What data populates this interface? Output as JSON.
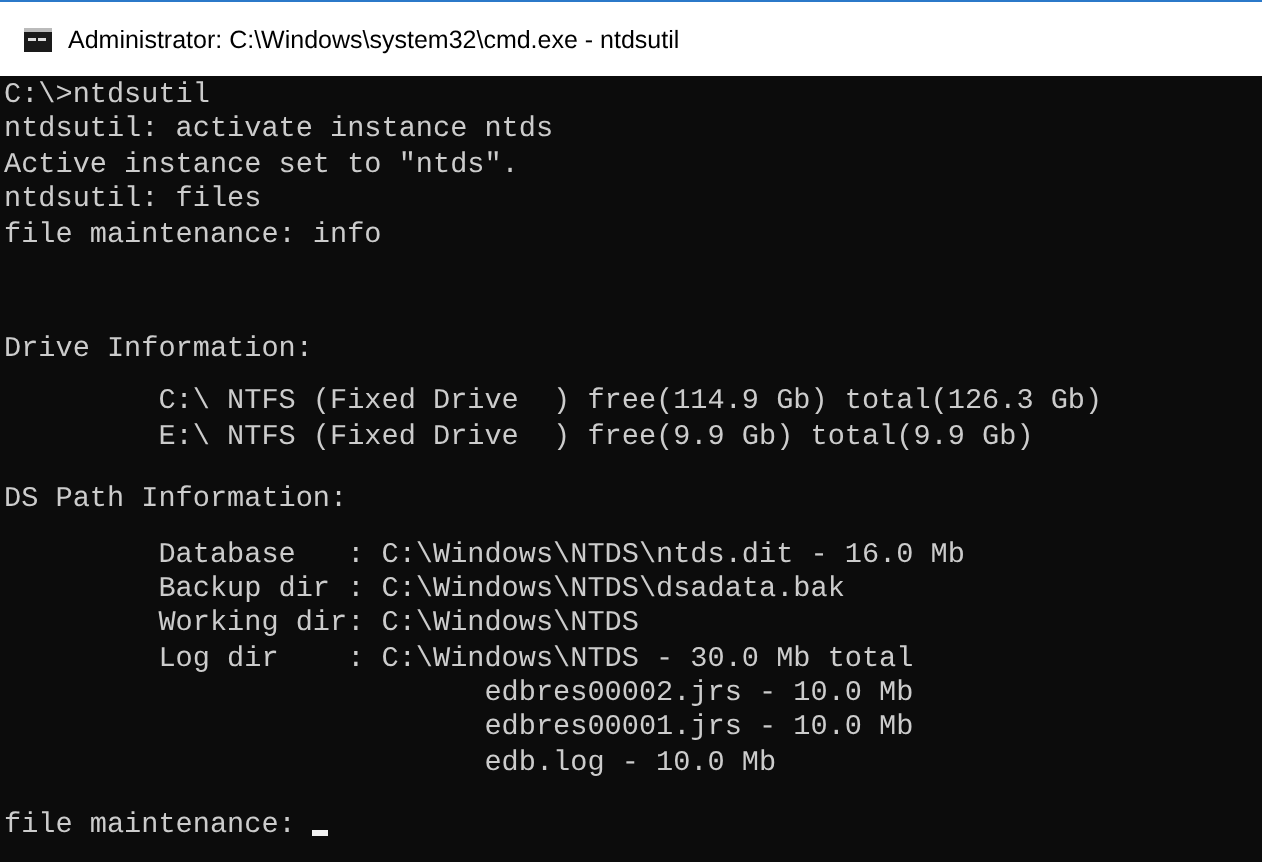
{
  "window": {
    "title": "Administrator: C:\\Windows\\system32\\cmd.exe - ntdsutil"
  },
  "console": {
    "blocks": [
      [
        "C:\\>ntdsutil",
        "ntdsutil: activate instance ntds",
        "Active instance set to \"ntds\".",
        "ntdsutil: files",
        "file maintenance: info"
      ],
      [
        "Drive Information:"
      ],
      [
        "         C:\\ NTFS (Fixed Drive  ) free(114.9 Gb) total(126.3 Gb)",
        "         E:\\ NTFS (Fixed Drive  ) free(9.9 Gb) total(9.9 Gb)"
      ],
      [
        "DS Path Information:"
      ],
      [
        "         Database   : C:\\Windows\\NTDS\\ntds.dit - 16.0 Mb",
        "         Backup dir : C:\\Windows\\NTDS\\dsadata.bak",
        "         Working dir: C:\\Windows\\NTDS",
        "         Log dir    : C:\\Windows\\NTDS - 30.0 Mb total",
        "                            edbres00002.jrs - 10.0 Mb",
        "                            edbres00001.jrs - 10.0 Mb",
        "                            edb.log - 10.0 Mb"
      ],
      [
        "file maintenance: "
      ]
    ],
    "cursor": true
  }
}
